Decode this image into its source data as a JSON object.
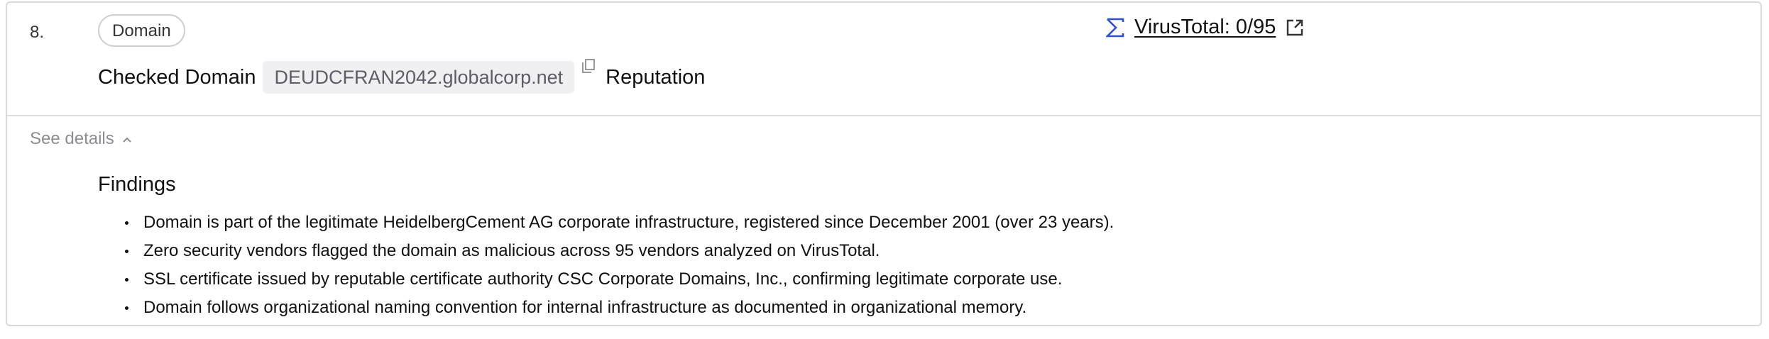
{
  "step": {
    "number": "8."
  },
  "tag": {
    "label": "Domain"
  },
  "title": {
    "prefix": "Checked Domain",
    "domain": "DEUDCFRAN2042.globalcorp.net",
    "suffix": "Reputation"
  },
  "virustotal": {
    "label": "VirusTotal: 0/95",
    "icon": "sigma-icon",
    "link_icon": "external-link-icon"
  },
  "details": {
    "toggle_label": "See details",
    "toggle_icon": "chevron-up-icon"
  },
  "findings": {
    "title": "Findings",
    "items": [
      "Domain is part of the legitimate HeidelbergCement AG corporate infrastructure, registered since December 2001 (over 23 years).",
      "Zero security vendors flagged the domain as malicious across 95 vendors analyzed on VirusTotal.",
      "SSL certificate issued by reputable certificate authority CSC Corporate Domains, Inc., confirming legitimate corporate use.",
      "Domain follows organizational naming convention for internal infrastructure as documented in organizational memory."
    ]
  },
  "colors": {
    "border": "#d9d9dc",
    "chip_bg": "#f0f0f2",
    "chip_text": "#5d5d68",
    "sigma_blue": "#2f4fd8",
    "muted": "#8c8c94"
  }
}
